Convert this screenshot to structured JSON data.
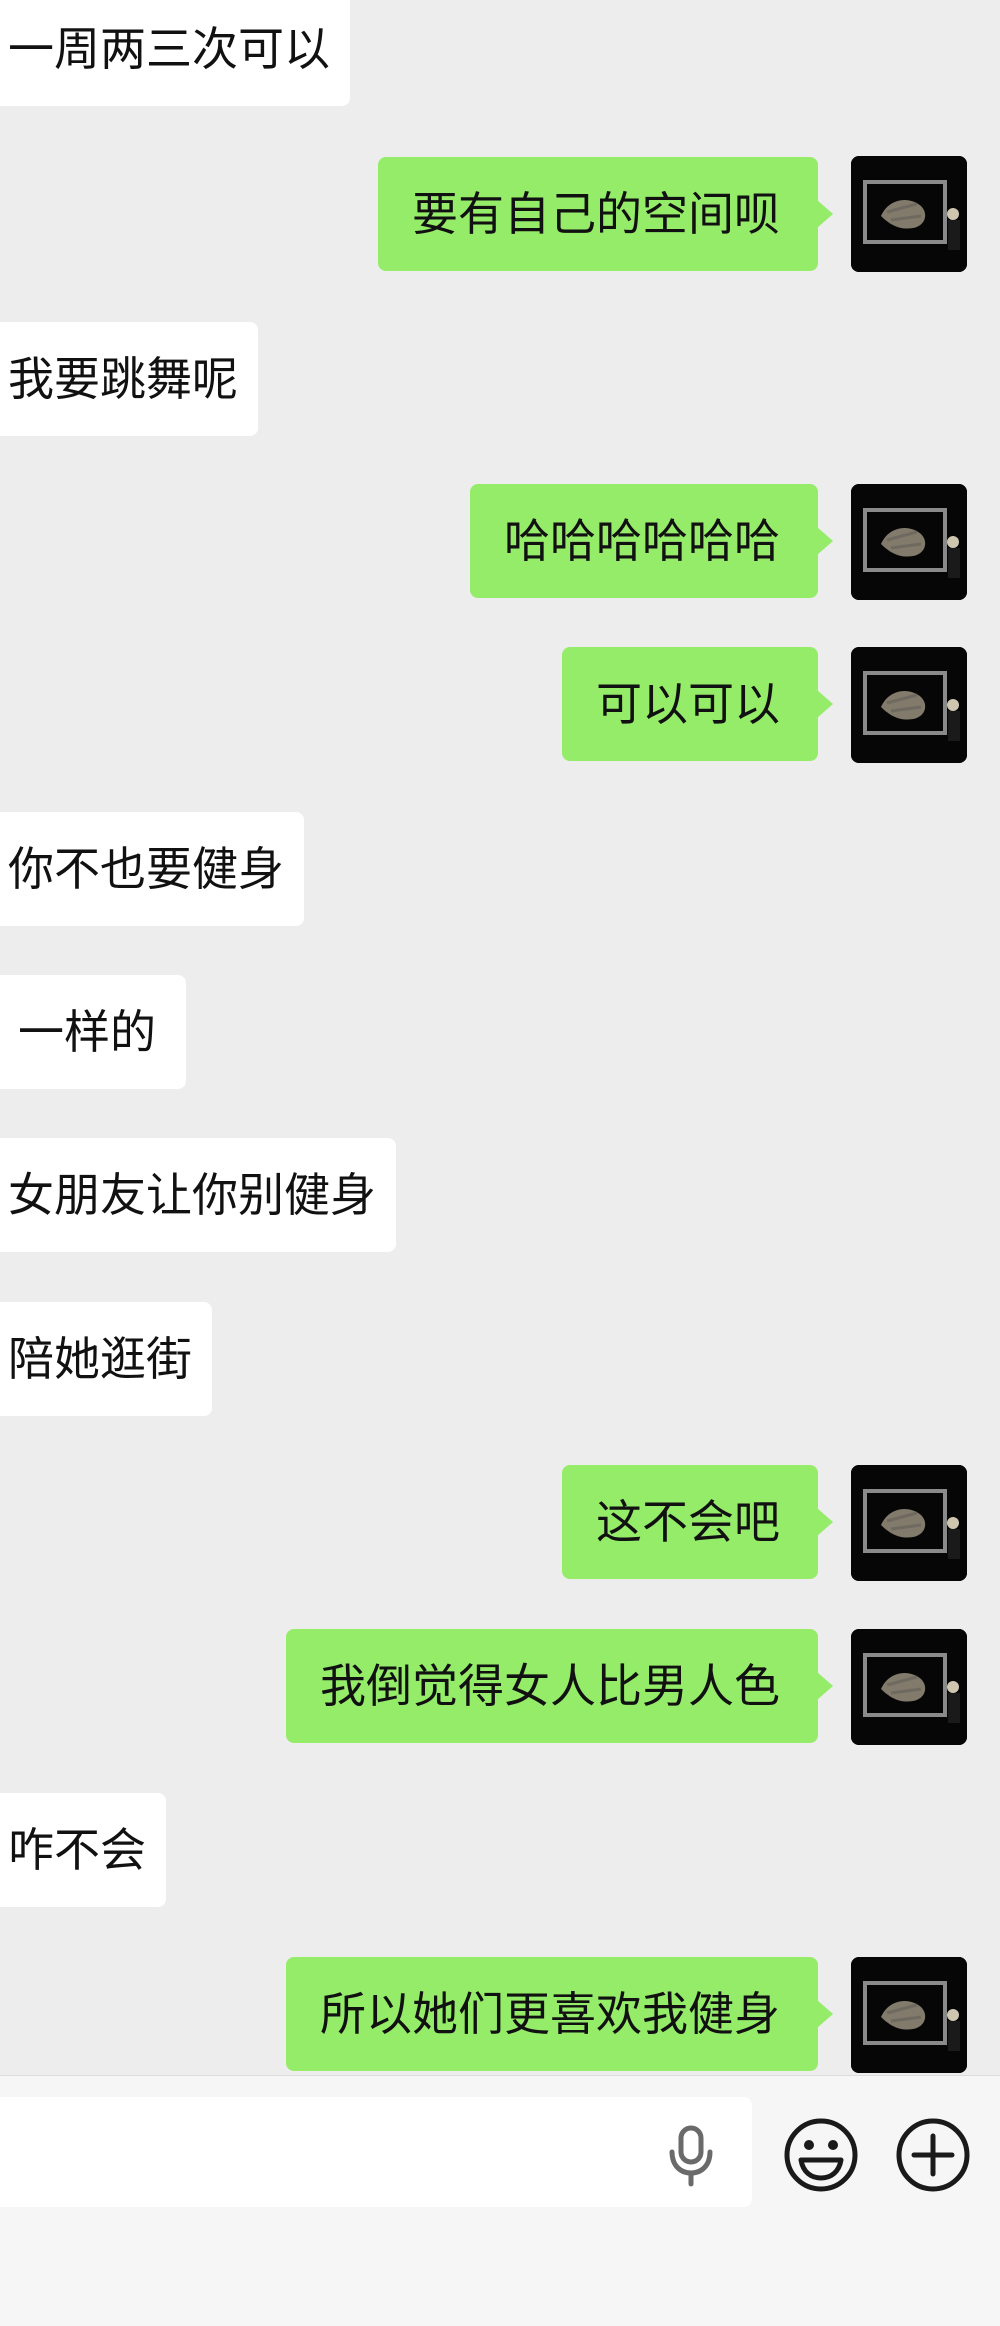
{
  "chat": {
    "messages": [
      {
        "side": "left",
        "text": "一周两三次可以"
      },
      {
        "side": "right",
        "text": "要有自己的空间呗"
      },
      {
        "side": "left",
        "text": "我要跳舞呢"
      },
      {
        "side": "right",
        "text": "哈哈哈哈哈哈"
      },
      {
        "side": "right",
        "text": "可以可以"
      },
      {
        "side": "left",
        "text": "你不也要健身"
      },
      {
        "side": "left",
        "text": "一样的"
      },
      {
        "side": "left",
        "text": "女朋友让你别健身"
      },
      {
        "side": "left",
        "text": "陪她逛街"
      },
      {
        "side": "right",
        "text": "这不会吧"
      },
      {
        "side": "right",
        "text": "我倒觉得女人比男人色"
      },
      {
        "side": "left",
        "text": "咋不会"
      },
      {
        "side": "right",
        "text": "所以她们更喜欢我健身"
      }
    ]
  },
  "input_bar": {
    "text": "",
    "icons": [
      "voice-mic-icon",
      "emoji-icon",
      "plus-icon"
    ]
  },
  "colors": {
    "background": "#ededed",
    "own_bubble": "#95ec69",
    "other_bubble": "#ffffff",
    "input_bar": "#f6f6f6"
  }
}
